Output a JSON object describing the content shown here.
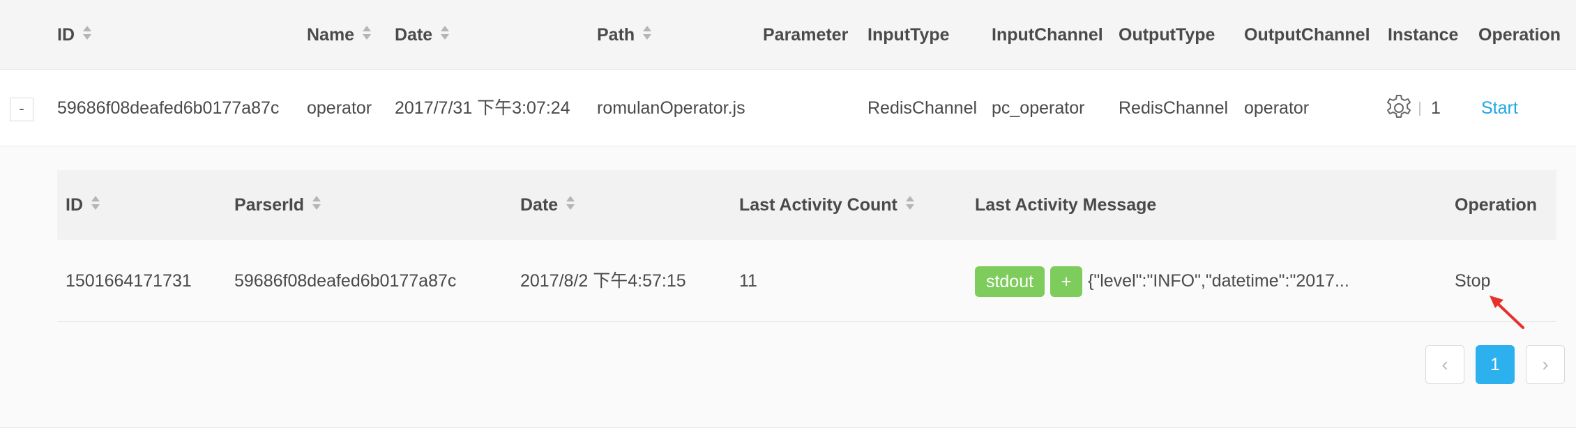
{
  "main_table": {
    "columns": [
      "ID",
      "Name",
      "Date",
      "Path",
      "Parameter",
      "InputType",
      "InputChannel",
      "OutputType",
      "OutputChannel",
      "Instance",
      "Operation"
    ],
    "row": {
      "expand_symbol": "-",
      "id": "59686f08deafed6b0177a87c",
      "name": "operator",
      "date": "2017/7/31 下午3:07:24",
      "path": "romulanOperator.js",
      "parameter": "",
      "input_type": "RedisChannel",
      "input_channel": "pc_operator",
      "output_type": "RedisChannel",
      "output_channel": "operator",
      "instance_icon": "gear-icon",
      "instance_count": "1",
      "operation": "Start"
    }
  },
  "sub_table": {
    "columns": [
      "ID",
      "ParserId",
      "Date",
      "Last Activity Count",
      "Last Activity Message",
      "Operation"
    ],
    "row": {
      "id": "1501664171731",
      "parser_id": "59686f08deafed6b0177a87c",
      "date": "2017/8/2 下午4:57:15",
      "last_activity_count": "11",
      "tag": "stdout",
      "expand_tag": "+",
      "message": "{\"level\":\"INFO\",\"datetime\":\"2017...",
      "operation": "Stop"
    }
  },
  "pagination": {
    "prev": "‹",
    "current": "1",
    "next": "›"
  },
  "colors": {
    "link": "#1ea6e6",
    "tag": "#7dcc5c",
    "page_active": "#2db0ee",
    "annotation_arrow": "#e8302a"
  }
}
